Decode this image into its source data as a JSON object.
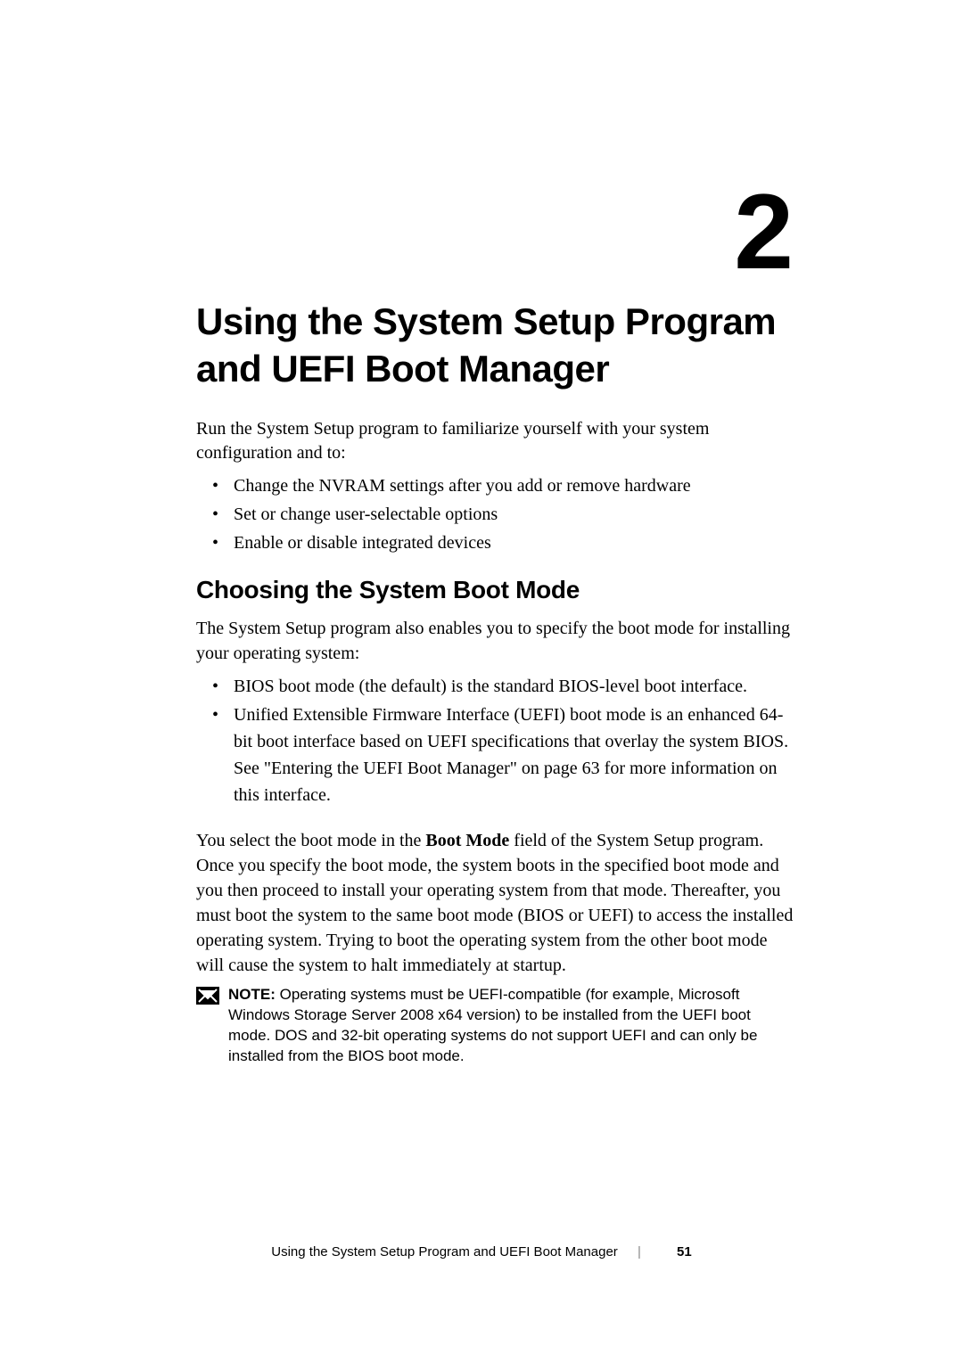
{
  "chapter": {
    "number": "2",
    "title": "Using the System Setup Program and UEFI Boot Manager"
  },
  "intro": "Run the System Setup program to familiarize yourself with your system configuration and to:",
  "intro_bullets": [
    "Change the NVRAM settings after you add or remove hardware",
    "Set or change user-selectable options",
    "Enable or disable integrated devices"
  ],
  "section": {
    "title": "Choosing the System Boot Mode",
    "lead": "The System Setup program also enables you to specify the boot mode for installing your operating system:",
    "bullets": [
      "BIOS boot mode (the default) is the standard BIOS-level boot interface.",
      "Unified Extensible Firmware Interface (UEFI) boot mode is an enhanced 64-bit boot interface based on UEFI specifications that overlay the system BIOS. See \"Entering the UEFI Boot Manager\" on page 63 for more information on this interface."
    ],
    "para_pre": "You select the boot mode in the ",
    "para_bold": "Boot Mode",
    "para_post": " field of the System Setup program. Once you specify the boot mode, the system boots in the specified boot mode and you then proceed to install your operating system from that mode. Thereafter, you must boot the system to the same boot mode (BIOS or UEFI) to access the installed operating system. Trying to boot the operating system from the other boot mode will cause the system to halt immediately at startup."
  },
  "note": {
    "label": "NOTE:",
    "text": " Operating systems must be UEFI-compatible (for example, Microsoft Windows Storage Server 2008 x64 version) to be installed from the UEFI boot mode. DOS and 32-bit operating systems do not support UEFI and can only be installed from the BIOS boot mode."
  },
  "footer": {
    "text": "Using the System Setup Program and UEFI Boot Manager",
    "page": "51"
  }
}
